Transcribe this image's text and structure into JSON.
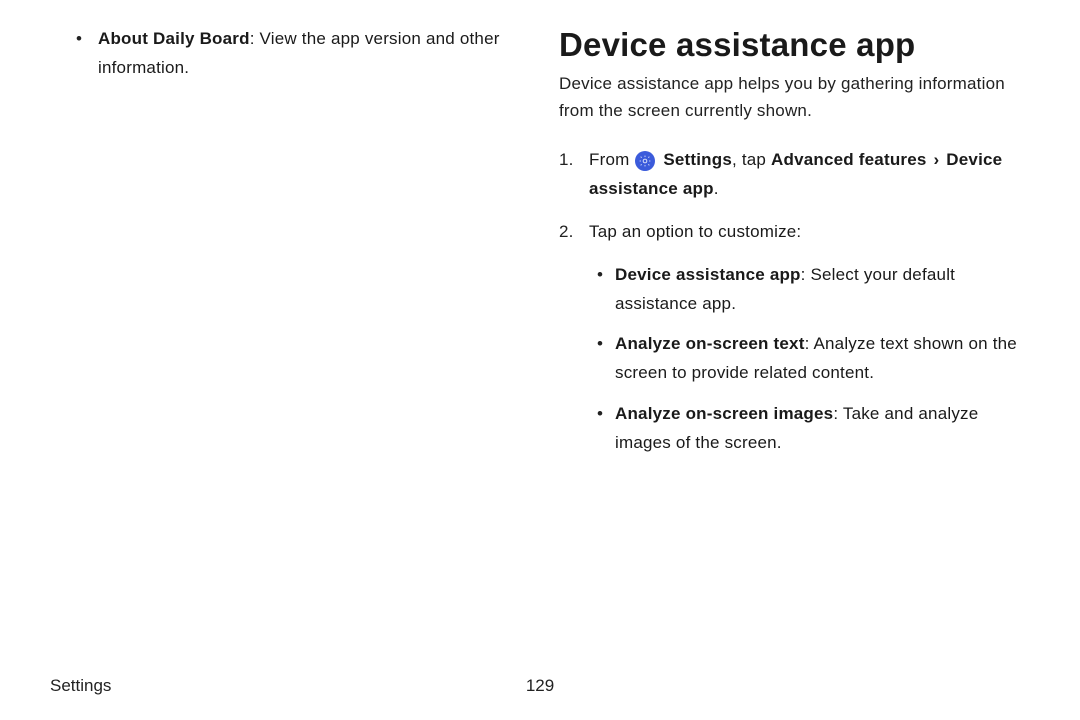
{
  "left": {
    "bullet_bold": "About Daily Board",
    "bullet_rest": ": View the app version and other information."
  },
  "right": {
    "heading": "Device assistance app",
    "intro": "Device assistance app helps you by gathering information from the screen currently shown.",
    "step1_prefix": "From ",
    "step1_settings": "Settings",
    "step1_tap": ", tap ",
    "step1_advanced": "Advanced features",
    "step1_device_assist": "Device assistance app",
    "step1_period": ".",
    "step2": "Tap an option to customize:",
    "sub": [
      {
        "bold": "Device assistance app",
        "rest": ": Select your default assistance app."
      },
      {
        "bold": "Analyze on-screen text",
        "rest": ": Analyze text shown on the screen to provide related content."
      },
      {
        "bold": "Analyze on-screen images",
        "rest": ": Take and analyze images of the screen."
      }
    ]
  },
  "footer": {
    "section": "Settings",
    "page": "129"
  }
}
